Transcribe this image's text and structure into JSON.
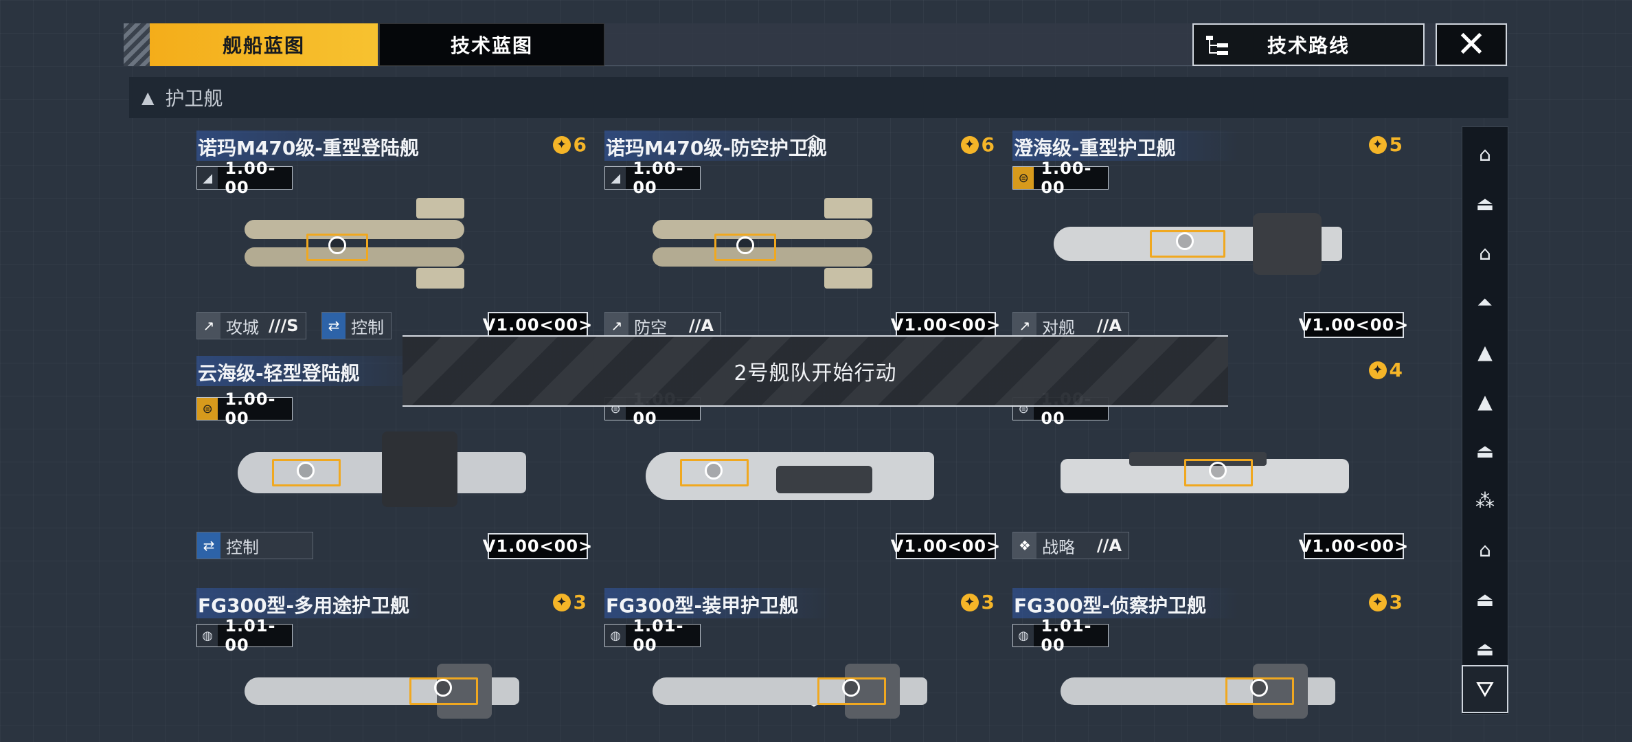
{
  "tabs": {
    "active": "舰船蓝图",
    "inactive": "技术蓝图"
  },
  "route_button": {
    "label": "技术路线"
  },
  "close_icon": "close-icon",
  "category": {
    "label": "护卫舰"
  },
  "toast": {
    "text": "2号舰队开始行动"
  },
  "colors": {
    "accent": "#f4ad1a",
    "cost": "#f5b528",
    "tag_blue": "#2d63a8"
  },
  "cards": [
    {
      "title": "诺玛M470级-重型登陆舰",
      "cost": "6",
      "tier": "1.00-00",
      "tags": [
        {
          "label": "攻城",
          "grade": "///S"
        },
        {
          "label": "控制",
          "grade": ""
        }
      ],
      "version": "V1.00<00>"
    },
    {
      "title": "诺玛M470级-防空护卫舰",
      "cost": "6",
      "tier": "1.00-00",
      "tags": [
        {
          "label": "防空",
          "grade": "//A"
        }
      ],
      "version": "V1.00<00>"
    },
    {
      "title": "澄海级-重型护卫舰",
      "cost": "5",
      "tier": "1.00-00",
      "tags": [
        {
          "label": "对舰",
          "grade": "//A"
        }
      ],
      "version": "V1.00<00>"
    },
    {
      "title": "云海级-轻型登陆舰",
      "cost": "",
      "tier": "1.00-00",
      "tags": [
        {
          "label": "控制",
          "grade": ""
        }
      ],
      "version": "V1.00<00>"
    },
    {
      "title": "",
      "cost": "",
      "tier": "1.00-00",
      "tags": [],
      "version": "V1.00<00>"
    },
    {
      "title": "",
      "cost": "4",
      "tier": "1.00-00",
      "tags": [
        {
          "label": "战略",
          "grade": "//A"
        }
      ],
      "version": "V1.00<00>"
    },
    {
      "title": "FG300型-多用途护卫舰",
      "cost": "3",
      "tier": "1.01-00",
      "tags": [],
      "version": ""
    },
    {
      "title": "FG300型-装甲护卫舰",
      "cost": "3",
      "tier": "1.01-00",
      "tags": [],
      "version": ""
    },
    {
      "title": "FG300型-侦察护卫舰",
      "cost": "3",
      "tier": "1.01-00",
      "tags": [],
      "version": ""
    }
  ],
  "rail": {
    "icons": [
      "ship-class-1-icon",
      "ship-class-2-icon",
      "ship-class-3-icon",
      "ship-class-4-icon",
      "ship-class-5-icon",
      "ship-class-6-icon",
      "ship-class-7-icon",
      "ship-class-8-icon",
      "ship-class-9-icon",
      "ship-class-10-icon",
      "ship-class-11-icon"
    ],
    "filter_icon": "filter-icon"
  }
}
